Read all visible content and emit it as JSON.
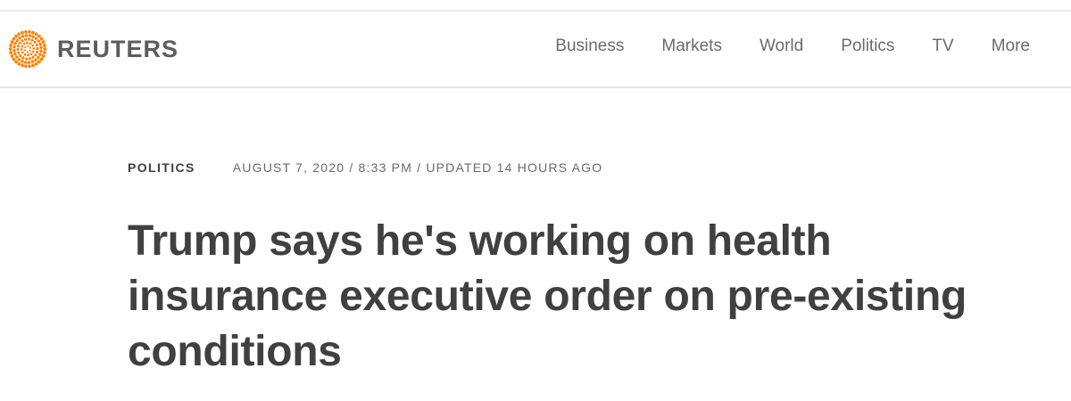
{
  "brand": {
    "name": "REUTERS",
    "accent_color": "#ff8000",
    "logo_icon": "reuters-dot-circle-icon"
  },
  "nav": {
    "items": [
      {
        "label": "Business"
      },
      {
        "label": "Markets"
      },
      {
        "label": "World"
      },
      {
        "label": "Politics"
      },
      {
        "label": "TV"
      },
      {
        "label": "More"
      }
    ]
  },
  "article": {
    "section": "POLITICS",
    "dateline": "AUGUST 7, 2020 / 8:33 PM / UPDATED 14 HOURS AGO",
    "headline": "Trump says he's working on health insurance executive order on pre-existing conditions"
  }
}
